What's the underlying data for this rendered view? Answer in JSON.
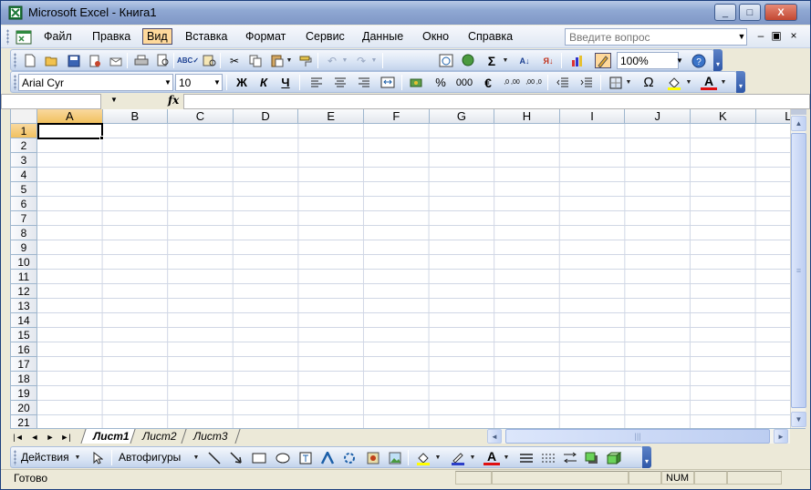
{
  "window": {
    "title": "Microsoft Excel - Книга1",
    "controls": {
      "minimize": "_",
      "maximize": "□",
      "close": "X"
    }
  },
  "menubar": {
    "items": [
      {
        "label": "Файл"
      },
      {
        "label": "Правка"
      },
      {
        "label": "Вид",
        "active": true
      },
      {
        "label": "Вставка"
      },
      {
        "label": "Формат"
      },
      {
        "label": "Сервис"
      },
      {
        "label": "Данные"
      },
      {
        "label": "Окно"
      },
      {
        "label": "Справка"
      }
    ],
    "help_placeholder": "Введите вопрос",
    "mdi": {
      "minimize": "–",
      "restore": "▣",
      "close": "×"
    }
  },
  "standard_toolbar": {
    "zoom": "100%",
    "icons": [
      "new-icon",
      "open-icon",
      "save-icon",
      "permission-icon",
      "email-icon",
      "print-icon",
      "print-preview-icon",
      "spelling-icon",
      "research-icon",
      "cut-icon",
      "copy-icon",
      "paste-icon",
      "format-painter-icon",
      "undo-icon",
      "redo-icon",
      "hyperlink-icon",
      "autosum-icon",
      "sort-asc-icon",
      "sort-desc-icon",
      "chart-wizard-icon",
      "drawing-icon",
      "help-icon"
    ]
  },
  "format_toolbar": {
    "font": "Arial Cyr",
    "size": "10",
    "bold": "Ж",
    "italic": "К",
    "underline": "Ч",
    "percent": "%",
    "thousands": "000",
    "euro": "€",
    "inc_dec": ",0 ,00",
    "dec_dec": ",00 ,0",
    "symbol": "Ω",
    "font_color": "A"
  },
  "formula_bar": {
    "fx": "fx",
    "value": ""
  },
  "grid": {
    "columns": [
      "A",
      "B",
      "C",
      "D",
      "E",
      "F",
      "G",
      "H",
      "I",
      "J",
      "K",
      "L"
    ],
    "rows": [
      "1",
      "2",
      "3",
      "4",
      "5",
      "6",
      "7",
      "8",
      "9",
      "10",
      "11",
      "12",
      "13",
      "14",
      "15",
      "16",
      "17",
      "18",
      "19",
      "20",
      "21"
    ],
    "selected_cell": "A1"
  },
  "sheets": {
    "tabs": [
      "Лист1",
      "Лист2",
      "Лист3"
    ],
    "active": "Лист1"
  },
  "drawing_toolbar": {
    "actions": "Действия",
    "autoshapes": "Автофигуры"
  },
  "status": {
    "text": "Готово",
    "num": "NUM"
  },
  "colors": {
    "selection_highlight": "#f1c15f",
    "toolbar_blue": "#c3d3ec",
    "grid_line": "#d0d7e5"
  }
}
